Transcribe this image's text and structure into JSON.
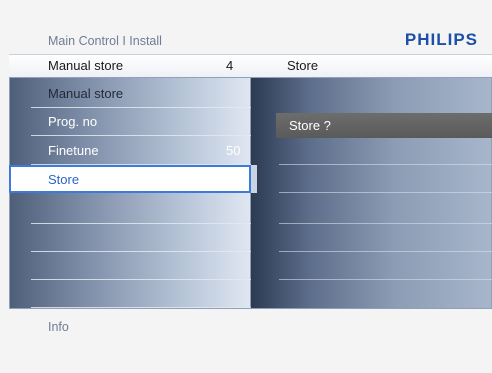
{
  "header": {
    "breadcrumb": "Main Control I Install",
    "brand": "PHILIPS",
    "left_label": "Manual store",
    "left_value": "4",
    "right_label": "Store"
  },
  "menu": {
    "items": [
      {
        "label": "Manual store",
        "value": ""
      },
      {
        "label": "Prog. no",
        "value": ""
      },
      {
        "label": "Finetune",
        "value": "50"
      },
      {
        "label": "Store",
        "value": ""
      }
    ]
  },
  "submenu": {
    "items": [
      {
        "label": "Store ?"
      }
    ]
  },
  "footer": {
    "info": "Info"
  },
  "colors": {
    "brand": "#1c4fa8",
    "selection_border": "#3c7bdc",
    "selection_text": "#2a66c8"
  }
}
